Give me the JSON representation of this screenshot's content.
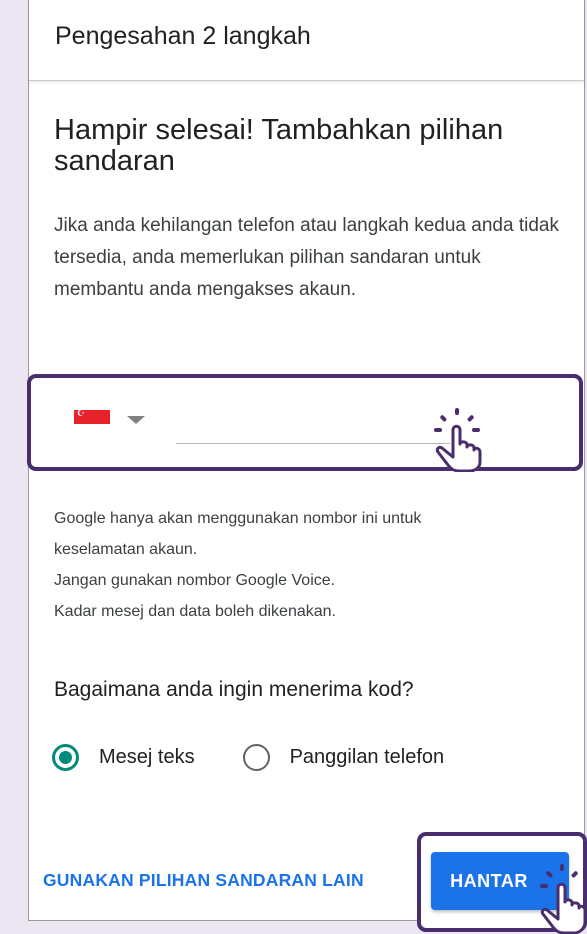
{
  "header": {
    "title": "Pengesahan 2 langkah"
  },
  "main": {
    "heading": "Hampir selesai! Tambahkan pilihan sandaran",
    "description": "Jika anda kehilangan telefon atau langkah kedua anda tidak tersedia, anda memerlukan pilihan sandaran untuk membantu anda mengakses akaun."
  },
  "phone": {
    "country_flag": "singapore-flag-icon",
    "number_value": "",
    "placeholder": ""
  },
  "notes": [
    "Google hanya akan menggunakan nombor ini untuk",
    "keselamatan akaun.",
    "Jangan gunakan nombor Google Voice.",
    "Kadar mesej dan data boleh dikenakan."
  ],
  "code_method": {
    "question": "Bagaimana anda ingin menerima kod?",
    "options": [
      {
        "label": "Mesej teks",
        "selected": true
      },
      {
        "label": "Panggilan telefon",
        "selected": false
      }
    ]
  },
  "actions": {
    "other_backup_label": "GUNAKAN PILIHAN SANDARAN LAIN",
    "submit_label": "HANTAR"
  },
  "colors": {
    "highlight_border": "#4a2d6d",
    "accent_blue": "#1a73e8",
    "radio_teal": "#01897b",
    "background": "#ebe6f1"
  }
}
